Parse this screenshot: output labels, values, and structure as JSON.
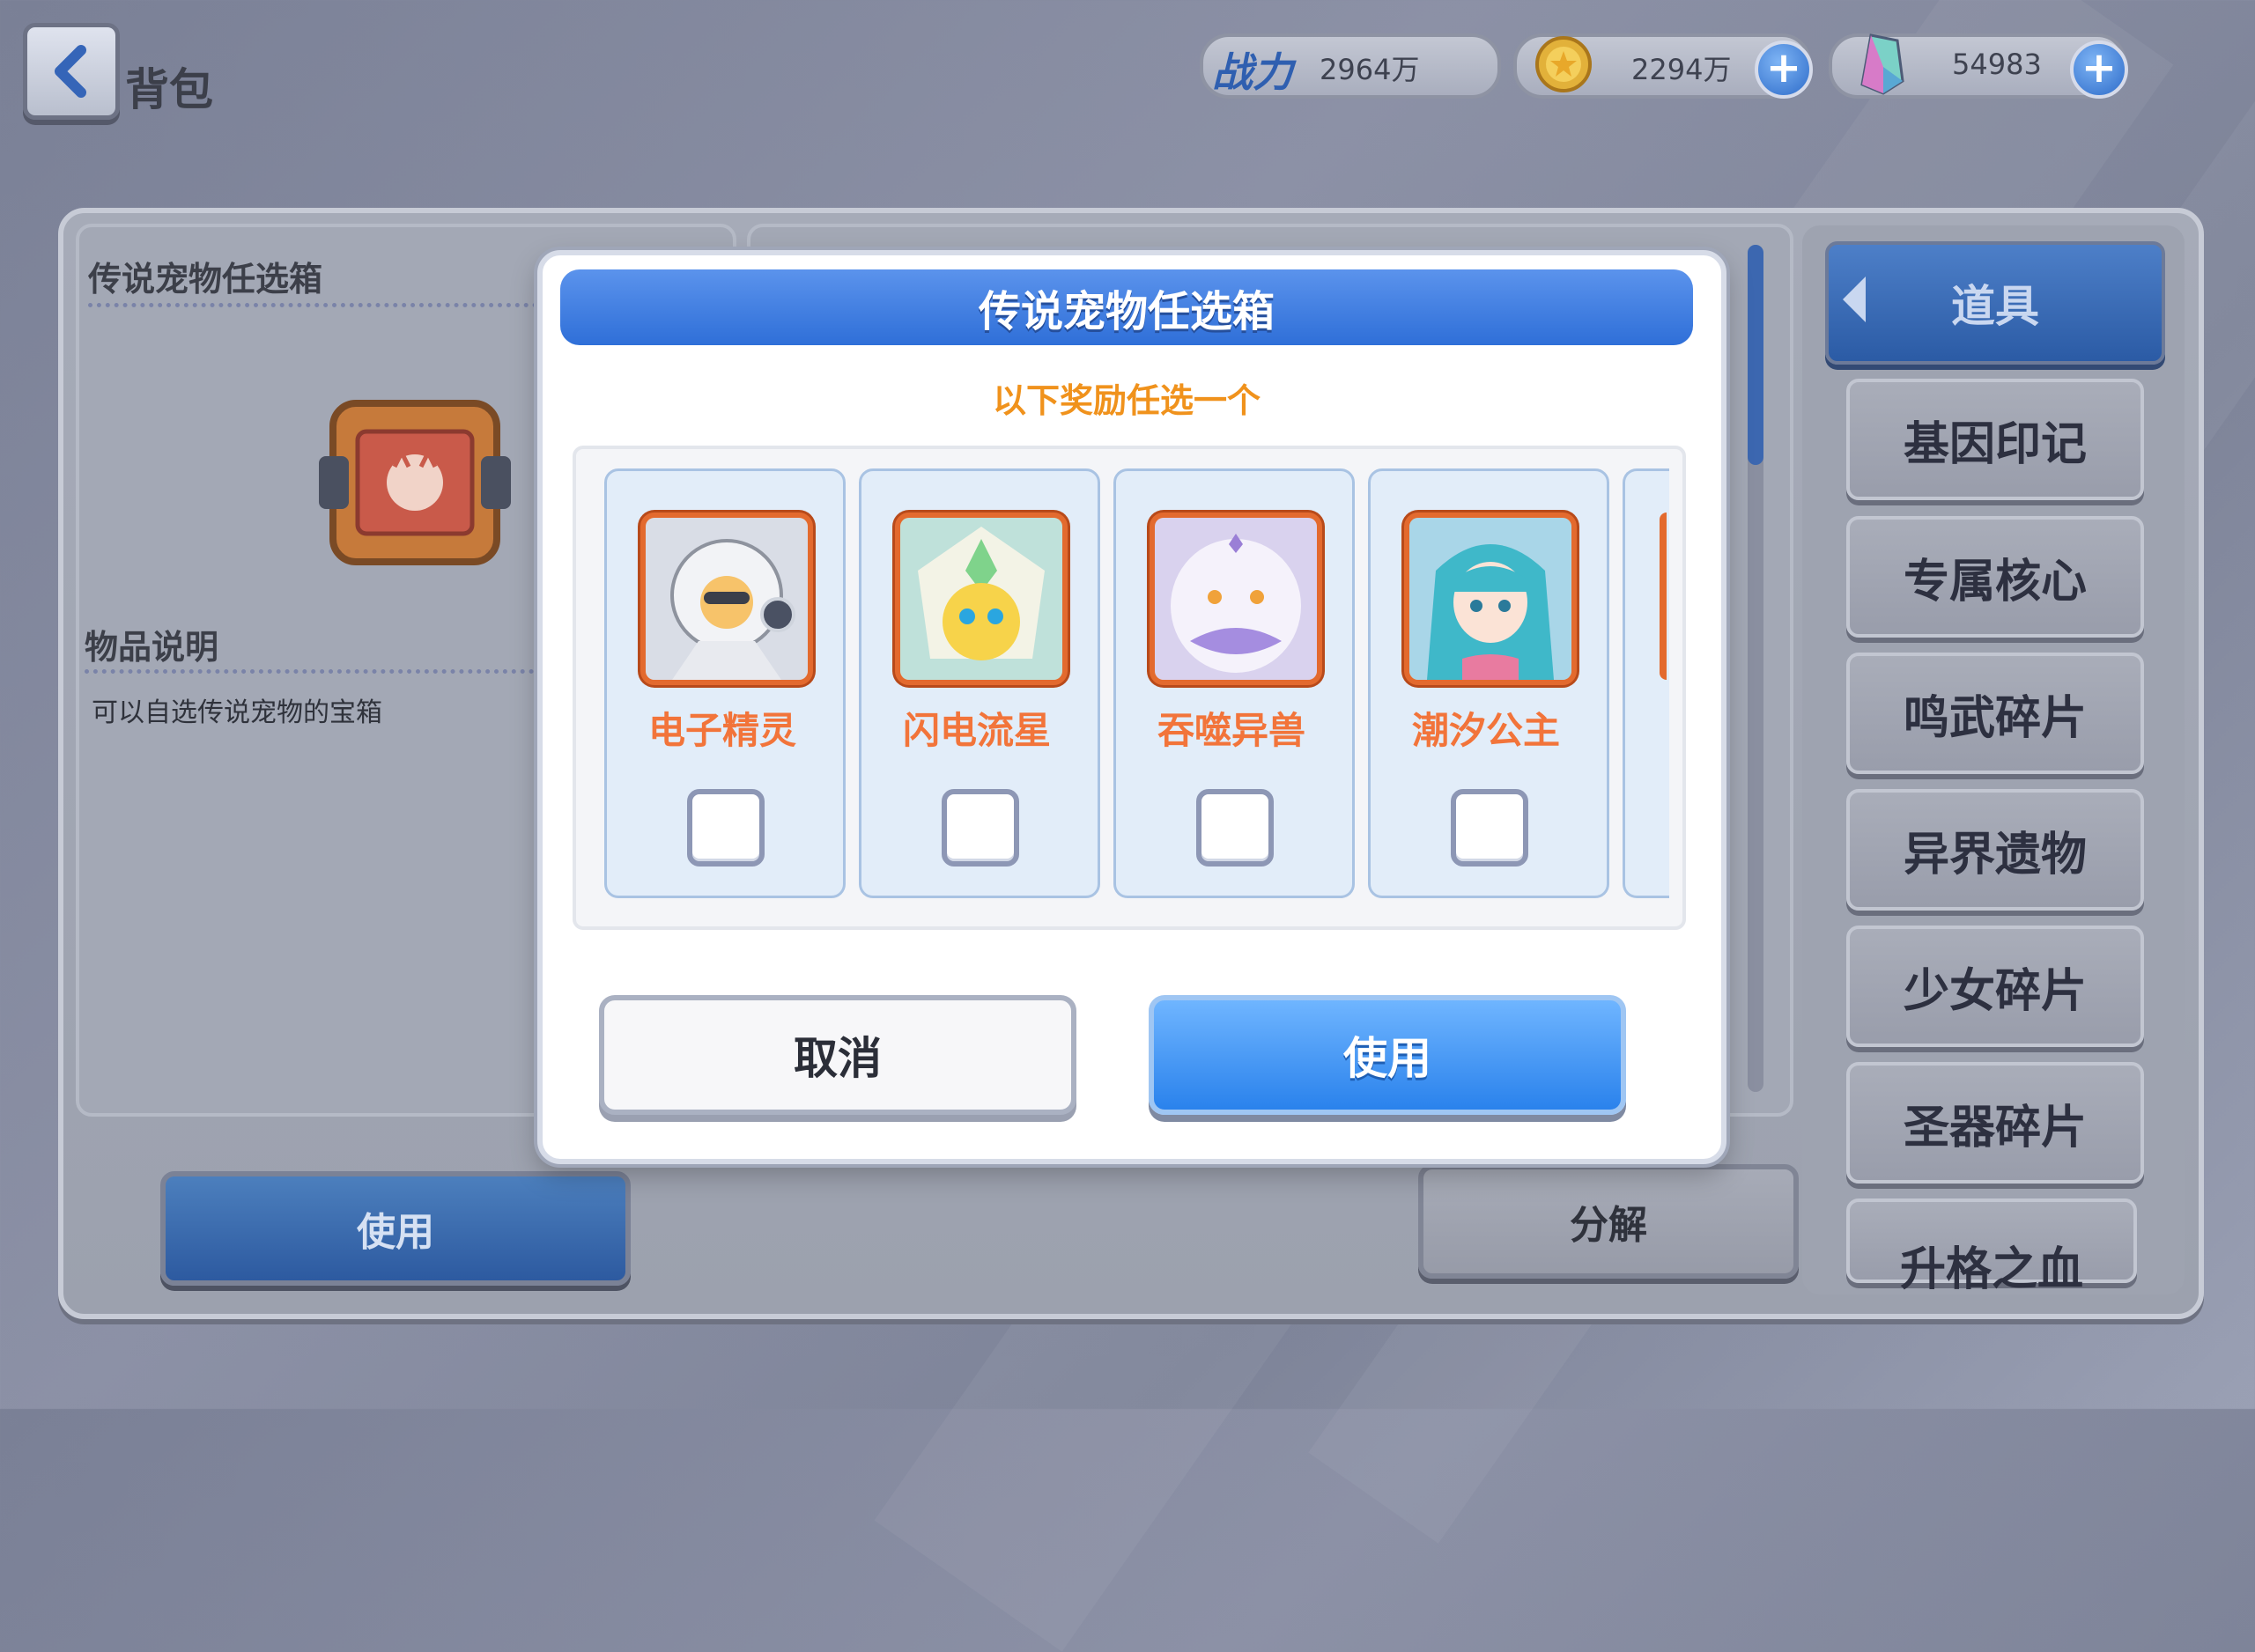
{
  "header": {
    "title": "背包",
    "combat_label": "战力",
    "combat_value": "2964万",
    "gold_value": "2294万",
    "gem_value": "54983"
  },
  "item_detail": {
    "name": "传说宠物任选箱",
    "desc_title": "物品说明",
    "desc_text": "可以自选传说宠物的宝箱",
    "use_label": "使用"
  },
  "inventory": {
    "decompose_label": "分解"
  },
  "categories": {
    "active": "道具",
    "items": [
      {
        "label": "基因印记"
      },
      {
        "label": "专属核心"
      },
      {
        "label": "鸣武碎片"
      },
      {
        "label": "异界遗物"
      },
      {
        "label": "少女碎片"
      },
      {
        "label": "圣器碎片"
      },
      {
        "label": "升格之血"
      }
    ]
  },
  "modal": {
    "title": "传说宠物任选箱",
    "subtitle": "以下奖励任选一个",
    "options": [
      {
        "name": "电子精灵",
        "checked": false
      },
      {
        "name": "闪电流星",
        "checked": false
      },
      {
        "name": "吞噬异兽",
        "checked": false
      },
      {
        "name": "潮汐公主",
        "checked": false
      }
    ],
    "cancel_label": "取消",
    "confirm_label": "使用"
  },
  "colors": {
    "accent_blue": "#2f6fd8",
    "pet_name_orange": "#f2743a",
    "subtitle_orange": "#f0921c"
  }
}
